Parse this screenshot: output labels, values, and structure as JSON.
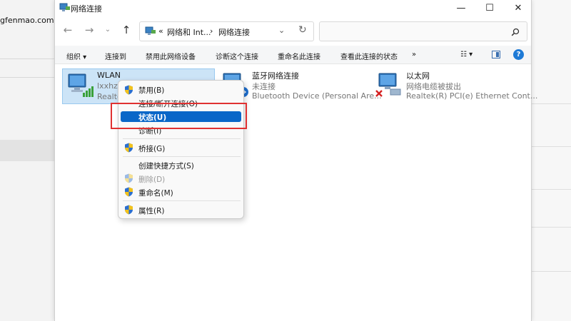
{
  "background": {
    "url_fragment": "gfenmao.com)"
  },
  "window": {
    "title": "网络连接",
    "controls": {
      "minimize": "—",
      "maximize": "☐",
      "close": "✕"
    }
  },
  "navigation": {
    "back": "←",
    "forward": "→",
    "recent": "⌄",
    "up": "↑",
    "breadcrumb": [
      "«",
      "网络和 Int...",
      "›",
      "网络连接"
    ],
    "dropdown": "⌄",
    "refresh": "↻",
    "search_placeholder": ""
  },
  "commandbar": {
    "items": [
      "组织 ▾",
      "连接到",
      "禁用此网络设备",
      "诊断这个连接",
      "重命名此连接",
      "查看此连接的状态",
      "»"
    ],
    "view_icon": "☷ ▾",
    "help": "?"
  },
  "connections": [
    {
      "name": "WLAN",
      "status": "lxxhz.c",
      "device": "Realte",
      "selected": true
    },
    {
      "name": "蓝牙网络连接",
      "status": "未连接",
      "device": "Bluetooth Device (Personal Are...",
      "selected": false
    },
    {
      "name": "以太网",
      "status": "网络电缆被拔出",
      "device": "Realtek(R) PCI(e) Ethernet Cont...",
      "selected": false
    }
  ],
  "context_menu": {
    "items": {
      "disable": "禁用(B)",
      "connect": "连接/断开连接(O)",
      "status": "状态(U)",
      "diagnose": "诊断(I)",
      "bridge": "桥接(G)",
      "shortcut": "创建快捷方式(S)",
      "delete": "删除(D)",
      "rename": "重命名(M)",
      "properties": "属性(R)"
    }
  },
  "colors": {
    "highlight": "#0a67c8",
    "annotation": "#e03131",
    "selection": "#cce4f7"
  }
}
